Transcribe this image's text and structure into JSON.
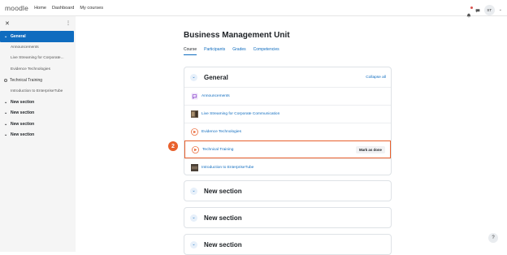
{
  "navbar": {
    "logo": "moodle",
    "links": [
      "Home",
      "Dashboard",
      "My courses"
    ],
    "avatar_initials": "ST",
    "caret": "⌄"
  },
  "drawer": {
    "close_glyph": "✕",
    "menu_glyph": "⋮",
    "items": [
      {
        "label": "General"
      },
      {
        "label": "Announcements"
      },
      {
        "label": "Live Streaming for Corporate..."
      },
      {
        "label": "Evidence Technologies"
      },
      {
        "label": "Technical Training"
      },
      {
        "label": "Introduction to EnterpriseTube"
      },
      {
        "label": "New section"
      },
      {
        "label": "New section"
      },
      {
        "label": "New section"
      },
      {
        "label": "New section"
      }
    ]
  },
  "course": {
    "title": "Business Management Unit",
    "tabs": [
      "Course",
      "Participants",
      "Grades",
      "Competencies"
    ]
  },
  "general_section": {
    "title": "General",
    "collapse_all": "Collapse all",
    "activities": [
      {
        "label": "Announcements",
        "icon": "forum-icon"
      },
      {
        "label": "Live Streaming for Corporate Communication",
        "icon": "video-thumbnail"
      },
      {
        "label": "Evidence Technologies",
        "icon": "enterprisetube-icon"
      },
      {
        "label": "Technical Training",
        "icon": "enterprisetube-icon",
        "button": "Mark as done"
      },
      {
        "label": "Introduction to EnterpriseTube",
        "icon": "video-thumbnail"
      }
    ]
  },
  "sections": [
    "New section",
    "New section",
    "New section"
  ],
  "step_badge": "2",
  "help": "?",
  "colors": {
    "primary": "#0f6cbf",
    "highlight": "#e8602c"
  }
}
